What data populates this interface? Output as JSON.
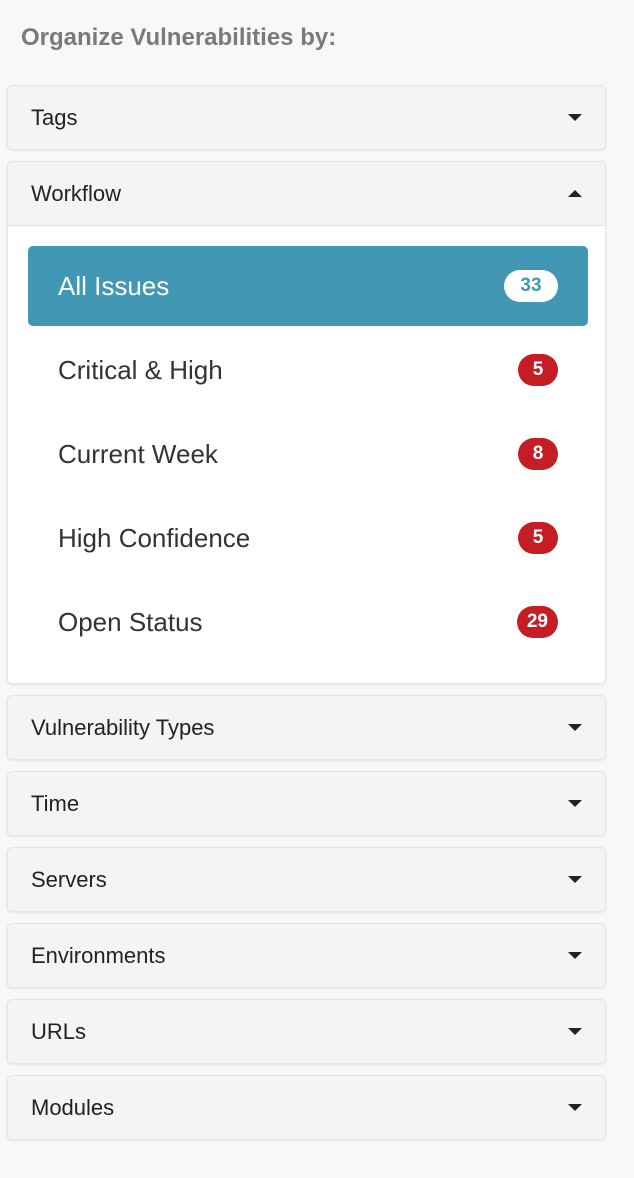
{
  "title": "Organize Vulnerabilities by:",
  "panels": [
    {
      "label": "Tags",
      "expanded": false
    },
    {
      "label": "Workflow",
      "expanded": true
    },
    {
      "label": "Vulnerability Types",
      "expanded": false
    },
    {
      "label": "Time",
      "expanded": false
    },
    {
      "label": "Servers",
      "expanded": false
    },
    {
      "label": "Environments",
      "expanded": false
    },
    {
      "label": "URLs",
      "expanded": false
    },
    {
      "label": "Modules",
      "expanded": false
    }
  ],
  "workflow_items": [
    {
      "label": "All Issues",
      "count": "33",
      "active": true
    },
    {
      "label": "Critical & High",
      "count": "5"
    },
    {
      "label": "Current Week",
      "count": "8"
    },
    {
      "label": "High Confidence",
      "count": "5"
    },
    {
      "label": "Open Status",
      "count": "29"
    }
  ],
  "colors": {
    "active": "#4297b5",
    "badge": "#c41e24"
  }
}
